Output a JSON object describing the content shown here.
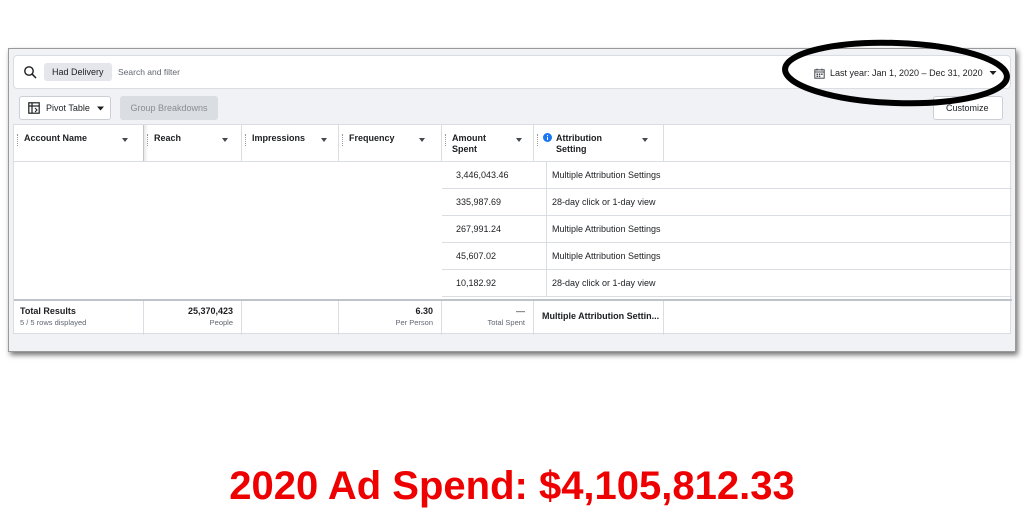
{
  "filter_bar": {
    "chip_label": "Had Delivery",
    "search_placeholder": "Search and filter",
    "date_range_label": "Last year: Jan 1, 2020 – Dec 31, 2020",
    "icons": [
      "search-icon",
      "calendar-icon",
      "caret-down-icon"
    ]
  },
  "toolbar": {
    "pivot_table_label": "Pivot Table",
    "group_breakdowns_label": "Group Breakdowns",
    "customize_label": "Customize"
  },
  "table": {
    "columns": [
      {
        "label": "Account Name"
      },
      {
        "label": "Reach"
      },
      {
        "label": "Impressions"
      },
      {
        "label": "Frequency"
      },
      {
        "label_line1": "Amount",
        "label_line2": "Spent"
      },
      {
        "label_line1": "Attribution",
        "label_line2": "Setting"
      }
    ],
    "rows": [
      {
        "amount_spent": "3,446,043.46",
        "attribution": "Multiple Attribution Settings"
      },
      {
        "amount_spent": "335,987.69",
        "attribution": "28-day click or 1-day view"
      },
      {
        "amount_spent": "267,991.24",
        "attribution": "Multiple Attribution Settings"
      },
      {
        "amount_spent": "45,607.02",
        "attribution": "Multiple Attribution Settings"
      },
      {
        "amount_spent": "10,182.92",
        "attribution": "28-day click or 1-day view"
      }
    ],
    "totals": {
      "label": "Total Results",
      "rows_displayed": "5 / 5 rows displayed",
      "reach": "25,370,423",
      "reach_unit": "People",
      "frequency": "6.30",
      "frequency_unit": "Per Person",
      "amount_spent": "—",
      "amount_spent_unit": "Total Spent",
      "attribution": "Multiple Attribution Settin..."
    }
  },
  "annotation": {
    "caption": "2020 Ad Spend: $4,105,812.33",
    "caption_color": "#ee0000",
    "ellipse_color": "#000000"
  },
  "colors": {
    "panel_bg": "#f0f2f5",
    "border": "#dadde1",
    "text": "#1c1e21",
    "info_blue": "#1877f2"
  }
}
